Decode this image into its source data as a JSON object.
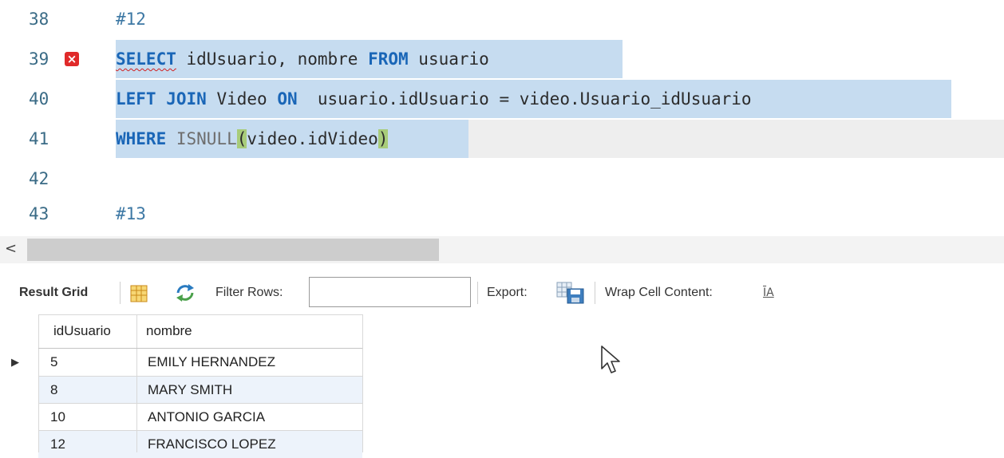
{
  "editor": {
    "lines": [
      {
        "num": "38",
        "text": "#12"
      },
      {
        "num": "39",
        "parts": [
          "SELECT",
          " idUsuario, nombre ",
          "FROM",
          " usuario"
        ]
      },
      {
        "num": "40",
        "parts": [
          "LEFT JOIN",
          " Video ",
          "ON",
          "  usuario.idUsuario = video.Usuario_idUsuario"
        ]
      },
      {
        "num": "41",
        "parts": [
          "WHERE",
          " ",
          "ISNULL",
          "(",
          "video.idVideo",
          ")"
        ]
      },
      {
        "num": "42",
        "text": ""
      },
      {
        "num": "43",
        "text": "#13"
      }
    ],
    "error_marker": "×"
  },
  "scrollbar": {
    "left_arrow": "<"
  },
  "toolbar": {
    "result_grid": "Result Grid",
    "filter_rows": "Filter Rows:",
    "filter_value": "",
    "export": "Export:",
    "wrap_cell": "Wrap Cell Content:",
    "wrap_icon": "ĪA"
  },
  "grid": {
    "columns": [
      "idUsuario",
      "nombre"
    ],
    "rows": [
      [
        "5",
        "EMILY HERNANDEZ"
      ],
      [
        "8",
        "MARY SMITH"
      ],
      [
        "10",
        "ANTONIO GARCIA"
      ],
      [
        "12",
        "FRANCISCO LOPEZ"
      ]
    ],
    "current_row_marker": "▶"
  },
  "colors": {
    "selection": "#c6dcf0",
    "keyword": "#1a66b7",
    "error": "#e02a2a",
    "paren_match": "#a8cc7a"
  }
}
